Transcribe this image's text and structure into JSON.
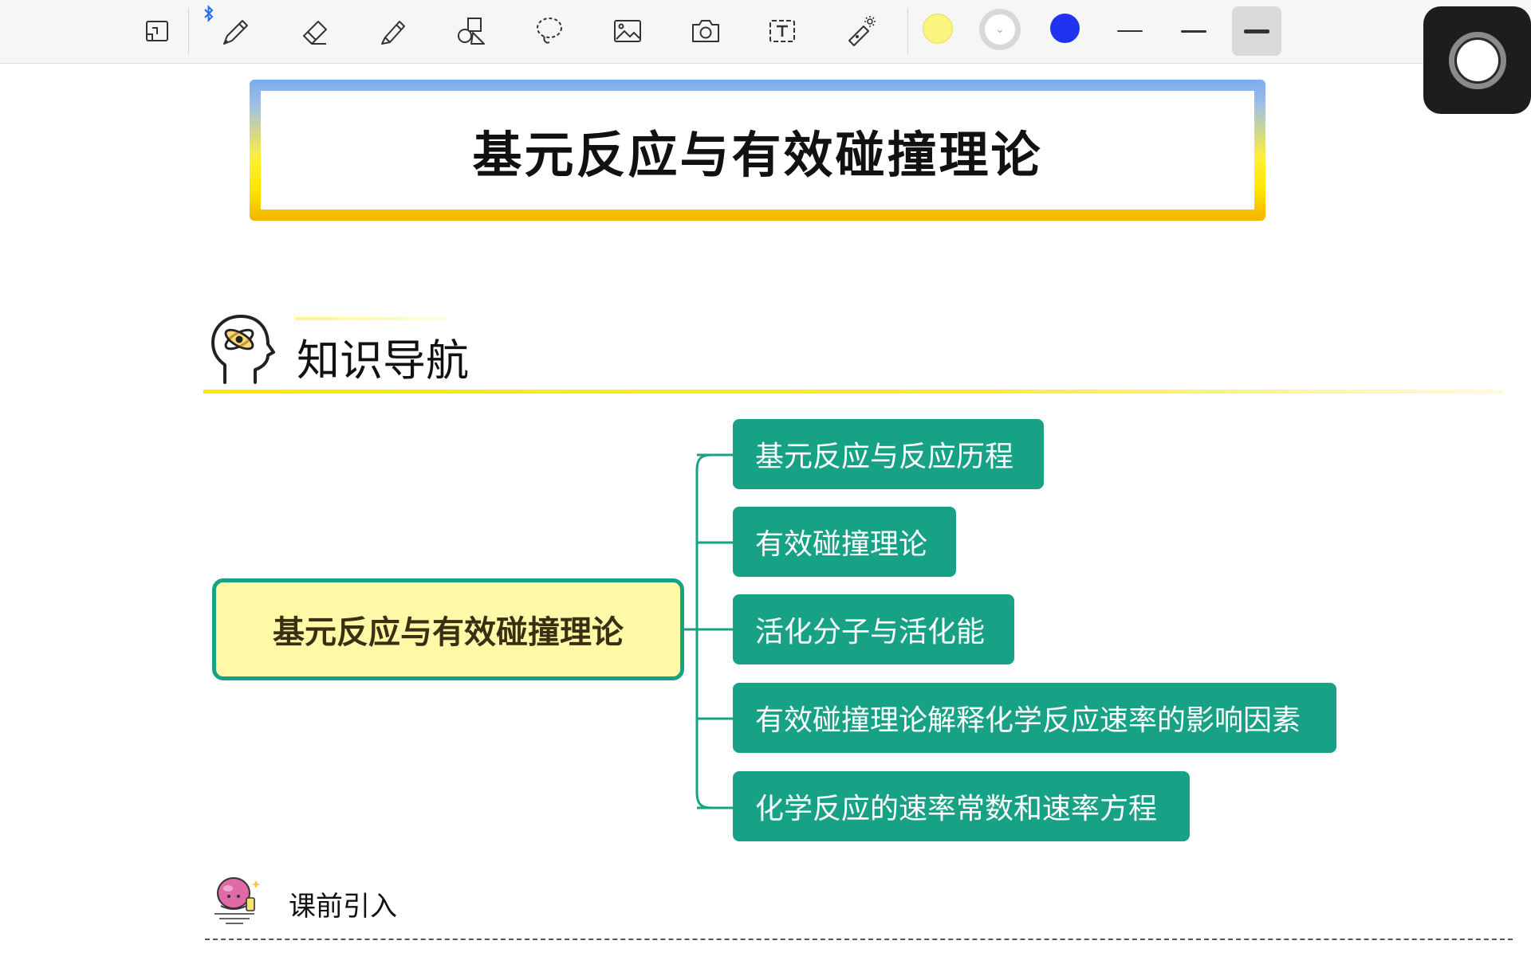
{
  "toolbar": {
    "tools": [
      {
        "name": "page-view",
        "icon": "page-view-icon"
      },
      {
        "name": "pen",
        "icon": "pen-icon"
      },
      {
        "name": "eraser",
        "icon": "eraser-icon"
      },
      {
        "name": "highlighter",
        "icon": "highlighter-icon"
      },
      {
        "name": "shapes",
        "icon": "shapes-icon"
      },
      {
        "name": "lasso",
        "icon": "lasso-icon"
      },
      {
        "name": "image",
        "icon": "image-icon"
      },
      {
        "name": "camera",
        "icon": "camera-icon"
      },
      {
        "name": "text",
        "icon": "text-box-icon"
      },
      {
        "name": "laser",
        "icon": "laser-pointer-icon"
      }
    ],
    "colors": [
      "#fbf57e",
      "#ffffff",
      "#2133f0"
    ],
    "selected_stroke": "thick"
  },
  "title": "基元反应与有效碰撞理论",
  "section": {
    "title": "知识导航"
  },
  "mindmap": {
    "root": "基元反应与有效碰撞理论",
    "branches": [
      "基元反应与反应历程",
      "有效碰撞理论",
      "活化分子与活化能",
      "有效碰撞理论解释化学反应速率的影响因素",
      "化学反应的速率常数和速率方程"
    ]
  },
  "intro": {
    "label": "课前引入"
  },
  "colors": {
    "accent": "#17a286",
    "root_fill": "#fdf9a6",
    "highlight_yellow": "#ffe600"
  }
}
